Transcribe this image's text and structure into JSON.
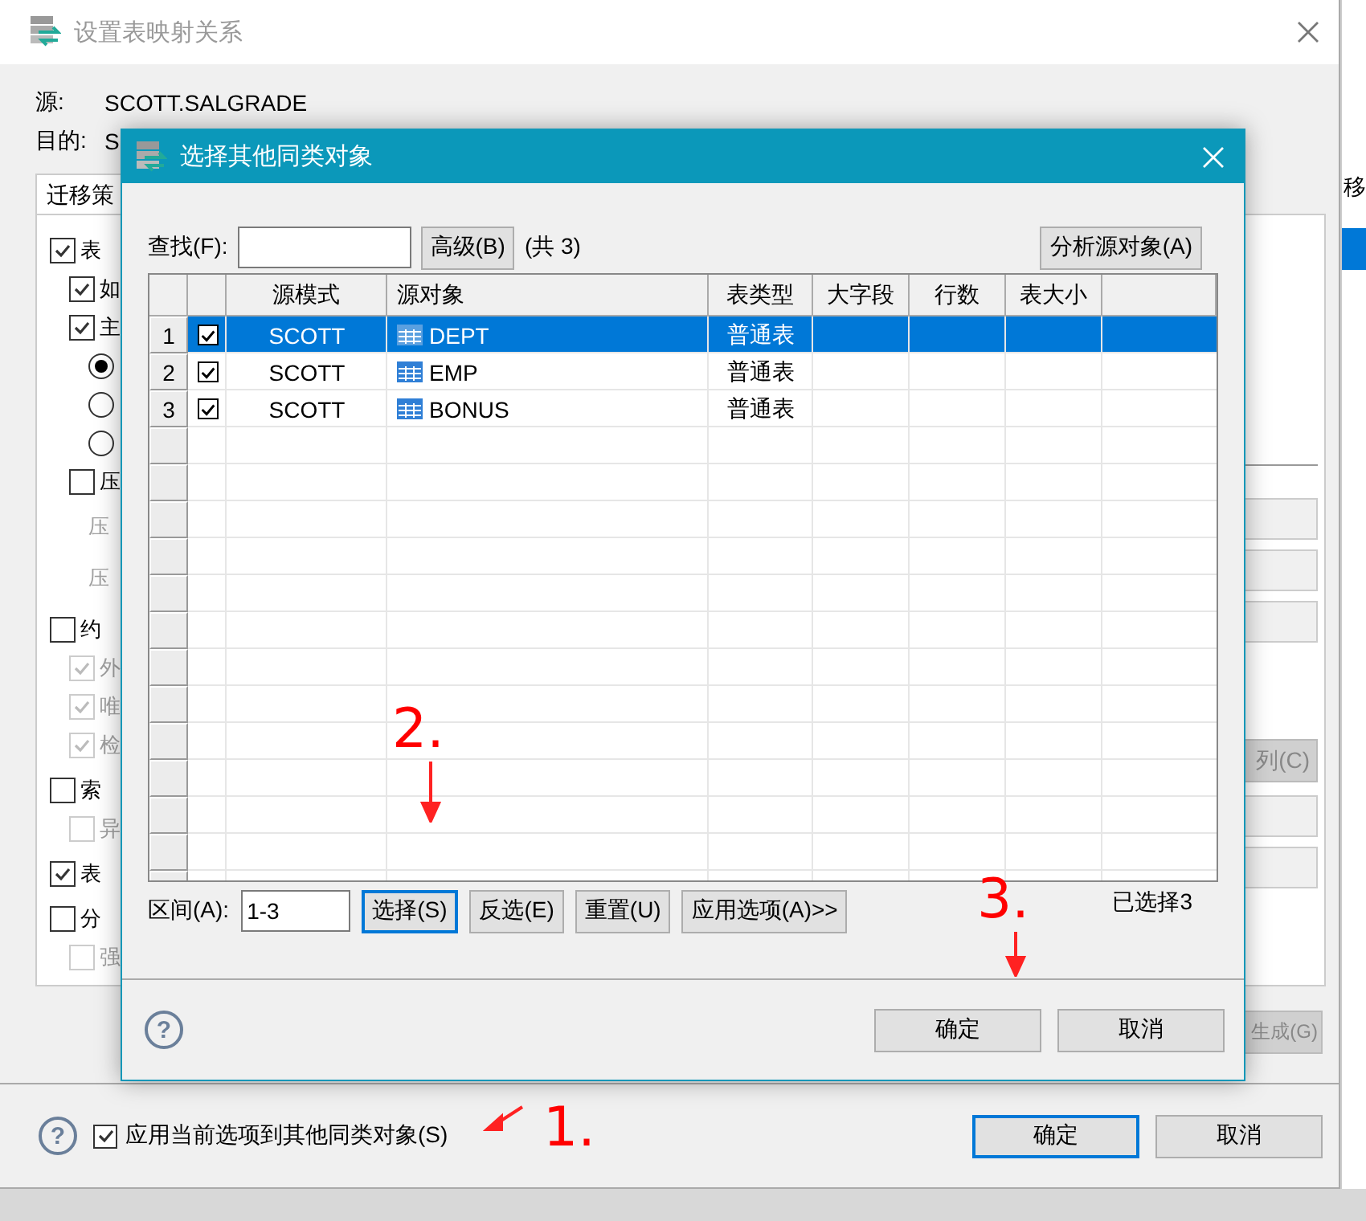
{
  "outer_window": {
    "title": "设置表映射关系"
  },
  "mapping": [
    {
      "label": "源:",
      "value": "SCOTT.SALGRADE"
    },
    {
      "label": "目的:",
      "value": "S"
    }
  ],
  "strategy_tab": {
    "label": "迁移策",
    "selected": true
  },
  "options": [
    {
      "kind": "checkbox",
      "label": "表",
      "checked": true,
      "disabled": false,
      "children": [
        {
          "kind": "checkbox",
          "label": "如",
          "checked": true,
          "disabled": false
        },
        {
          "kind": "checkbox",
          "label": "主",
          "checked": true,
          "disabled": false,
          "children": [
            {
              "kind": "radio",
              "selected": true,
              "disabled": false
            },
            {
              "kind": "radio",
              "selected": false,
              "disabled": false
            },
            {
              "kind": "radio",
              "selected": false,
              "disabled": false
            }
          ]
        },
        {
          "kind": "checkbox",
          "label": "压",
          "checked": false,
          "disabled": false,
          "children": [
            {
              "kind": "text",
              "label": "压",
              "disabled": true
            },
            {
              "kind": "text",
              "label": "压",
              "disabled": true
            }
          ]
        }
      ]
    },
    {
      "kind": "checkbox",
      "label": "约",
      "checked": false,
      "disabled": false,
      "children": [
        {
          "kind": "checkbox",
          "label": "外",
          "checked": true,
          "disabled": true
        },
        {
          "kind": "checkbox",
          "label": "唯",
          "checked": true,
          "disabled": true
        },
        {
          "kind": "checkbox",
          "label": "检",
          "checked": true,
          "disabled": true
        }
      ]
    },
    {
      "kind": "checkbox",
      "label": "索",
      "checked": false,
      "disabled": false,
      "children": [
        {
          "kind": "checkbox",
          "label": "异",
          "checked": false,
          "disabled": true
        }
      ]
    },
    {
      "kind": "checkbox",
      "label": "表",
      "checked": true,
      "disabled": false
    },
    {
      "kind": "checkbox",
      "label": "分",
      "checked": false,
      "disabled": false,
      "children": [
        {
          "kind": "checkbox",
          "label": "强",
          "checked": false,
          "disabled": true
        }
      ]
    }
  ],
  "side_buttons": [
    {
      "label": "列(C)",
      "disabled": true
    },
    {
      "label": "生成(G)",
      "disabled": true
    }
  ],
  "background_window": {
    "text": "移"
  },
  "footer": {
    "help": "?",
    "apply_checkbox": {
      "label": "应用当前选项到其他同类对象(S)",
      "checked": true
    },
    "buttons": [
      {
        "label": "确定",
        "focused": true
      },
      {
        "label": "取消",
        "focused": false
      }
    ]
  },
  "dialog": {
    "title": "选择其他同类对象",
    "search": {
      "label": "查找(F):"
    },
    "help": "?",
    "advanced_button": "高级(B)",
    "total": "(共 3)",
    "analyze_button": "分析源对象(A)",
    "columns": [
      "源模式",
      "源对象",
      "表类型",
      "大字段",
      "行数",
      "表大小"
    ],
    "rows": [
      {
        "number": "1",
        "checked": true,
        "selected": true,
        "schema": "SCOTT",
        "object": "DEPT",
        "table_type": "普通表"
      },
      {
        "number": "2",
        "checked": true,
        "selected": false,
        "schema": "SCOTT",
        "object": "EMP",
        "table_type": "普通表"
      },
      {
        "number": "3",
        "checked": true,
        "selected": false,
        "schema": "SCOTT",
        "object": "BONUS",
        "table_type": "普通表"
      }
    ],
    "range": {
      "label": "区间(A):",
      "value": "1-3"
    },
    "range_buttons": [
      {
        "label": "选择(S)",
        "focused": true
      },
      {
        "label": "反选(E)",
        "focused": false
      },
      {
        "label": "重置(U)",
        "focused": false
      },
      {
        "label": "应用选项(A)>>",
        "focused": false
      }
    ],
    "selected_count": "已选择3",
    "buttons": [
      {
        "label": "确定"
      },
      {
        "label": "取消"
      }
    ]
  },
  "annotations": [
    {
      "text": "1."
    },
    {
      "text": "2."
    },
    {
      "text": "3."
    }
  ]
}
